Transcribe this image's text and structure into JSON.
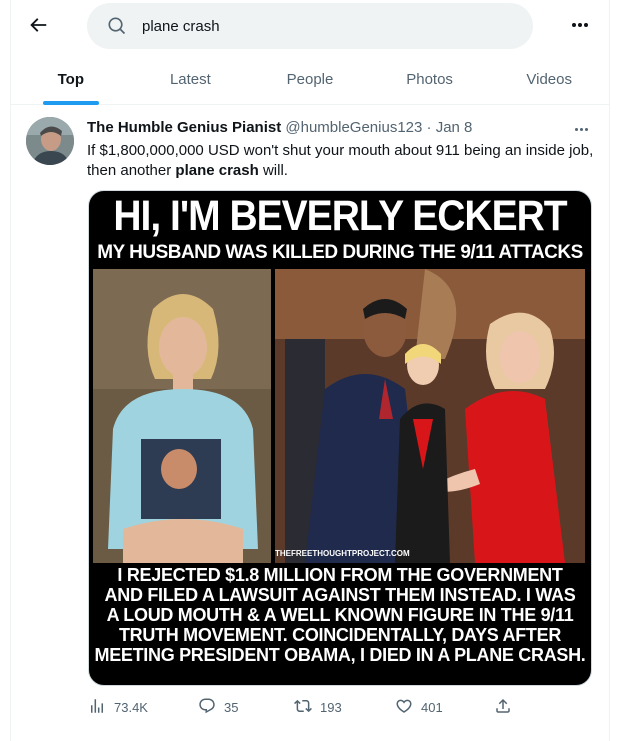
{
  "search": {
    "query": "plane crash"
  },
  "tabs": [
    {
      "label": "Top",
      "active": true
    },
    {
      "label": "Latest",
      "active": false
    },
    {
      "label": "People",
      "active": false
    },
    {
      "label": "Photos",
      "active": false
    },
    {
      "label": "Videos",
      "active": false
    }
  ],
  "tweet": {
    "display_name": "The Humble Genius Pianist",
    "handle": "@humbleGenius123",
    "separator": "·",
    "date": "Jan 8",
    "text_before": "If $1,800,000,000 USD won't shut your mouth about 911 being an inside job, then another ",
    "text_bold": "plane crash",
    "text_after": " will.",
    "media": {
      "title": "HI, I'M BEVERLY ECKERT",
      "subtitle": "MY HUSBAND WAS KILLED DURING THE 9/11 ATTACKS",
      "watermark": "THEFREETHOUGHTPROJECT.COM",
      "bottom_lines": [
        "I REJECTED $1.8 MILLION FROM THE GOVERNMENT",
        "AND FILED A LAWSUIT AGAINST THEM INSTEAD. I WAS",
        "A LOUD MOUTH & A WELL KNOWN FIGURE IN THE 9/11",
        "TRUTH MOVEMENT. COINCIDENTALLY, DAYS AFTER",
        "MEETING PRESIDENT OBAMA, I DIED IN A PLANE CRASH."
      ]
    },
    "stats": {
      "views": "73.4K",
      "replies": "35",
      "retweets": "193",
      "likes": "401"
    }
  },
  "icons": {
    "back": "arrow-left-icon",
    "search": "search-icon",
    "more": "more-horizontal-icon",
    "views": "bar-chart-icon",
    "reply": "reply-icon",
    "retweet": "retweet-icon",
    "like": "heart-icon",
    "share": "share-icon"
  },
  "colors": {
    "accent": "#1d9bf0",
    "muted": "#536471",
    "text": "#0f1419",
    "search_bg": "#eff3f4"
  }
}
